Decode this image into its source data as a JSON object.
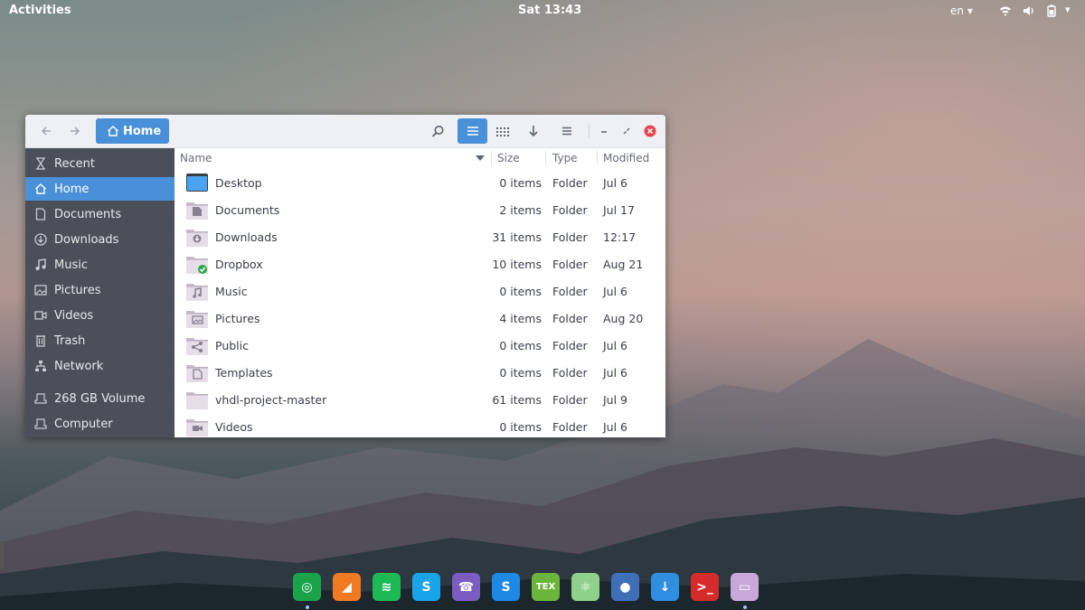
{
  "topbar": {
    "activities": "Activities",
    "clock": "Sat 13:43",
    "lang": "en"
  },
  "window": {
    "path_label": "Home",
    "columns": {
      "name": "Name",
      "size": "Size",
      "type": "Type",
      "modified": "Modified"
    },
    "sidebar": [
      {
        "label": "Recent",
        "icon": "clock-icon",
        "active": false
      },
      {
        "label": "Home",
        "icon": "home-icon",
        "active": true
      },
      {
        "label": "Documents",
        "icon": "document-icon",
        "active": false
      },
      {
        "label": "Downloads",
        "icon": "download-icon",
        "active": false
      },
      {
        "label": "Music",
        "icon": "music-icon",
        "active": false
      },
      {
        "label": "Pictures",
        "icon": "picture-icon",
        "active": false
      },
      {
        "label": "Videos",
        "icon": "video-icon",
        "active": false
      },
      {
        "label": "Trash",
        "icon": "trash-icon",
        "active": false
      },
      {
        "label": "Network",
        "icon": "network-icon",
        "active": false
      },
      {
        "label": "268 GB Volume",
        "icon": "drive-icon",
        "active": false
      },
      {
        "label": "Computer",
        "icon": "computer-icon",
        "active": false
      }
    ],
    "files": [
      {
        "name": "Desktop",
        "size": "0 items",
        "type": "Folder",
        "modified": "Jul 6",
        "icon": "desktop-folder-icon"
      },
      {
        "name": "Documents",
        "size": "2 items",
        "type": "Folder",
        "modified": "Jul 17",
        "icon": "documents-folder-icon"
      },
      {
        "name": "Downloads",
        "size": "31 items",
        "type": "Folder",
        "modified": "12:17",
        "icon": "downloads-folder-icon"
      },
      {
        "name": "Dropbox",
        "size": "10 items",
        "type": "Folder",
        "modified": "Aug 21",
        "icon": "dropbox-folder-icon"
      },
      {
        "name": "Music",
        "size": "0 items",
        "type": "Folder",
        "modified": "Jul 6",
        "icon": "music-folder-icon"
      },
      {
        "name": "Pictures",
        "size": "4 items",
        "type": "Folder",
        "modified": "Aug 20",
        "icon": "pictures-folder-icon"
      },
      {
        "name": "Public",
        "size": "0 items",
        "type": "Folder",
        "modified": "Jul 6",
        "icon": "public-folder-icon"
      },
      {
        "name": "Templates",
        "size": "0 items",
        "type": "Folder",
        "modified": "Jul 6",
        "icon": "templates-folder-icon"
      },
      {
        "name": "vhdl-project-master",
        "size": "61 items",
        "type": "Folder",
        "modified": "Jul 9",
        "icon": "folder-icon"
      },
      {
        "name": "Videos",
        "size": "0 items",
        "type": "Folder",
        "modified": "Jul 6",
        "icon": "videos-folder-icon"
      }
    ]
  },
  "dock": [
    {
      "name": "chrome-icon",
      "color": "#1ba34a",
      "glyph": "◎",
      "running": true
    },
    {
      "name": "app-icon",
      "color": "#f07a22",
      "glyph": "◢",
      "running": false
    },
    {
      "name": "spotify-icon",
      "color": "#1db954",
      "glyph": "≋",
      "running": false
    },
    {
      "name": "skype-icon",
      "color": "#1aa4e8",
      "glyph": "S",
      "running": false
    },
    {
      "name": "viber-icon",
      "color": "#7b5dc1",
      "glyph": "☎",
      "running": false
    },
    {
      "name": "messenger-icon",
      "color": "#1e88e5",
      "glyph": "S",
      "running": false
    },
    {
      "name": "tex-icon",
      "color": "#6bb53c",
      "glyph": "TEX",
      "running": false
    },
    {
      "name": "atom-icon",
      "color": "#8fd18a",
      "glyph": "⚛",
      "running": false
    },
    {
      "name": "drop-icon",
      "color": "#3f6fb6",
      "glyph": "●",
      "running": false
    },
    {
      "name": "download-manager-icon",
      "color": "#2f8ee0",
      "glyph": "↓",
      "running": false
    },
    {
      "name": "terminal-icon",
      "color": "#d52b2b",
      "glyph": ">_",
      "running": false
    },
    {
      "name": "files-icon",
      "color": "#c7a8d8",
      "glyph": "▭",
      "running": true
    }
  ]
}
